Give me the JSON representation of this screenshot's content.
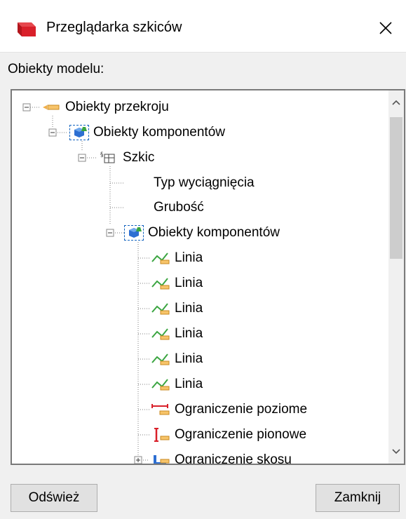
{
  "window": {
    "title": "Przeglądarka szkiców",
    "close_glyph": "✕"
  },
  "section_label": "Obiekty modelu:",
  "tree": {
    "items": [
      {
        "label": "Obiekty przekroju",
        "icon": "section-objects-icon",
        "toggle": "collapse"
      },
      {
        "label": "Obiekty komponentów",
        "icon": "component-objects-icon",
        "toggle": "collapse"
      },
      {
        "label": "Szkic",
        "icon": "sketch-icon",
        "toggle": "collapse"
      },
      {
        "label": "Typ wyciągnięcia",
        "icon": "",
        "toggle": "none"
      },
      {
        "label": "Grubość",
        "icon": "",
        "toggle": "none"
      },
      {
        "label": "Obiekty komponentów",
        "icon": "component-objects-icon",
        "toggle": "collapse"
      },
      {
        "label": "Linia",
        "icon": "line-icon",
        "toggle": "none"
      },
      {
        "label": "Linia",
        "icon": "line-icon",
        "toggle": "none"
      },
      {
        "label": "Linia",
        "icon": "line-icon",
        "toggle": "none"
      },
      {
        "label": "Linia",
        "icon": "line-icon",
        "toggle": "none"
      },
      {
        "label": "Linia",
        "icon": "line-icon",
        "toggle": "none"
      },
      {
        "label": "Linia",
        "icon": "line-icon",
        "toggle": "none"
      },
      {
        "label": "Ograniczenie poziome",
        "icon": "horizontal-constraint-icon",
        "toggle": "none"
      },
      {
        "label": "Ograniczenie pionowe",
        "icon": "vertical-constraint-icon",
        "toggle": "none"
      },
      {
        "label": "Ograniczenie skosu",
        "icon": "angle-constraint-icon",
        "toggle": "expand"
      }
    ]
  },
  "buttons": {
    "refresh": "Odśwież",
    "close": "Zamknij"
  },
  "colors": {
    "dialog_bg": "#f0f0f0",
    "accent_red": "#d9202a",
    "selection_blue": "#1565c0"
  }
}
